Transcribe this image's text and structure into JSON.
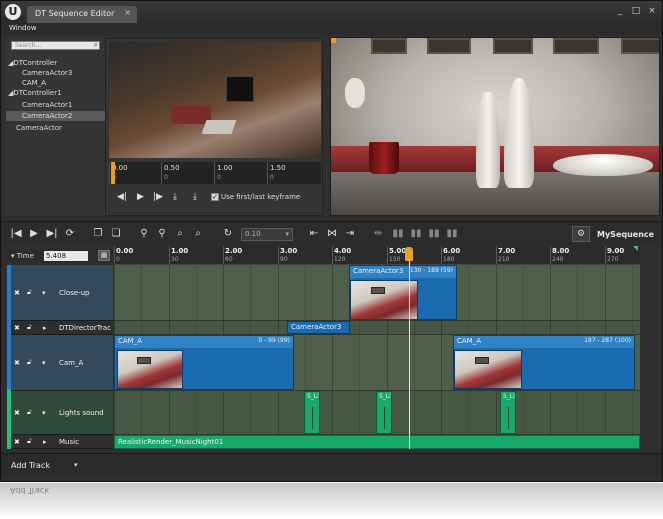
{
  "window": {
    "logo_letter": "U",
    "tab_title": "DT Sequence Editor",
    "tab_close": "×",
    "controls": [
      "_",
      "□",
      "×"
    ]
  },
  "menu": {
    "window": "Window"
  },
  "tree": {
    "search_placeholder": "Search...",
    "nodes": [
      {
        "label": "◢DTController",
        "indent": 0,
        "selected": false
      },
      {
        "label": "CameraActor3",
        "indent": 1,
        "selected": false
      },
      {
        "label": "CAM_A",
        "indent": 1,
        "selected": false
      },
      {
        "label": "◢DTController1",
        "indent": 0,
        "selected": false
      },
      {
        "label": "CameraActor1",
        "indent": 1,
        "selected": false
      },
      {
        "label": "CameraActor2",
        "indent": 1,
        "selected": true
      },
      {
        "label": "CameraActor",
        "indent": 0,
        "selected": false
      }
    ]
  },
  "preview": {
    "ruler": [
      {
        "major": "0.00",
        "minor": "0"
      },
      {
        "major": "0.50",
        "minor": "0"
      },
      {
        "major": "1.00",
        "minor": "0"
      },
      {
        "major": "1.50",
        "minor": "0"
      }
    ],
    "use_keyframe_label": "Use first/last keyframe",
    "use_keyframe_checked": true
  },
  "toolbar": {
    "speed_value": "0.10",
    "sequence_name": "MySequence ▾"
  },
  "timeline": {
    "time_label": "Time",
    "time_value": "5.408",
    "ruler": [
      {
        "major": "0.00",
        "minor": "0"
      },
      {
        "major": "1.00",
        "minor": "30"
      },
      {
        "major": "2.00",
        "minor": "60"
      },
      {
        "major": "3.00",
        "minor": "90"
      },
      {
        "major": "4.00",
        "minor": "120"
      },
      {
        "major": "5.00",
        "minor": "150"
      },
      {
        "major": "6.00",
        "minor": "180"
      },
      {
        "major": "7.00",
        "minor": "210"
      },
      {
        "major": "8.00",
        "minor": "240"
      },
      {
        "major": "9.00",
        "minor": "270"
      }
    ],
    "playhead_seconds": 5.408,
    "tracks": [
      {
        "name": "Close-up",
        "expandable": true
      },
      {
        "name": "DTDirectorTrac",
        "expandable": false
      },
      {
        "name": "Cam_A",
        "expandable": true
      },
      {
        "name": "Lights sound",
        "expandable": true
      },
      {
        "name": "Music",
        "expandable": false
      }
    ],
    "sections": {
      "closeup": {
        "label": "CameraActor3",
        "range": "130 - 189 (59)"
      },
      "director": {
        "label": "CameraActor3"
      },
      "cam_a_1": {
        "label": "CAM_A",
        "range": "0 - 99 (99)"
      },
      "cam_a_2": {
        "label": "CAM_A",
        "range": "187 - 287 (100)"
      },
      "sounds": [
        "S_Li",
        "S_Li",
        "S_Li"
      ],
      "music": "RealisticRender_MusicNight01"
    }
  },
  "add_track": {
    "label": "Add Track",
    "arrow": "▾"
  },
  "reflection": {
    "label": "Add Track"
  },
  "colors": {
    "accent": "#e8a21e",
    "section_blue": "#1b6bb0",
    "sound_green": "#1aa86a"
  }
}
